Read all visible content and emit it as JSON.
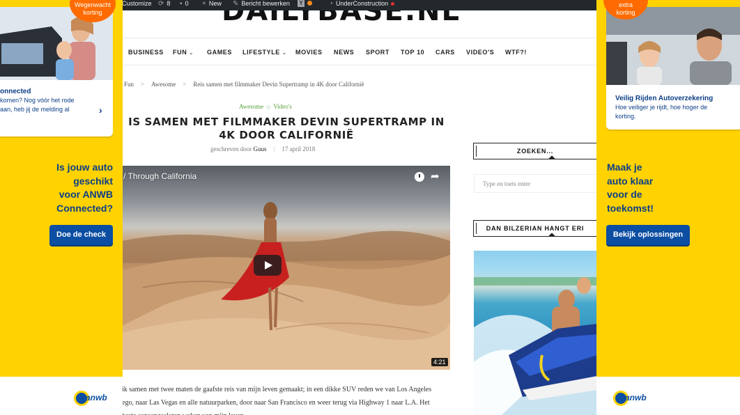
{
  "admin_bar": {
    "customize": "Customize",
    "updates_count": "8",
    "comments_count": "0",
    "new": "New",
    "edit_post": "Bericht bewerken",
    "under_construction": "UnderConstruction"
  },
  "site": {
    "logo": "DAILYBASE.NL"
  },
  "nav": {
    "items": [
      "BUSINESS",
      "FUN",
      "GAMES",
      "LIFESTYLE",
      "MOVIES",
      "NEWS",
      "SPORT",
      "TOP 10",
      "CARS",
      "VIDEO'S",
      "WTF?!"
    ]
  },
  "breadcrumb": [
    "Fun",
    "Awesome",
    "Reis samen met filmmaker Devin Supertramp in 4K door Californië"
  ],
  "post": {
    "categories": [
      "Awesome",
      "Video's"
    ],
    "title": "IS SAMEN MET FILMMAKER DEVIN SUPERTRAMP IN 4K DOOR CALIFORNIË",
    "written_by": "geschreven door",
    "author": "Guus",
    "date": "17 april 2018",
    "video": {
      "title": "/ Through California",
      "duration": "4:21"
    },
    "body_lines": [
      "ik samen met twee maten de gaafste reis van mijn leven gemaakt; in een dikke SUV reden we van Los Angeles",
      "ego, naar Las Vegas en alle natuurparken, door naar San Francisco en weer terug via Highway 1 naar L.A. Het",
      "beste aaneengesloten weken van mijn leven."
    ]
  },
  "sidebar": {
    "search_title": "ZOEKEN...",
    "search_placeholder": "Type en toets enter",
    "widget2_title": "DAN BILZERIAN HANGT ERI"
  },
  "ad_left": {
    "badge": [
      "Wegenwacht",
      "korting"
    ],
    "card_title": "onnected",
    "card_lines": [
      "komen? Nog vóór het rode",
      "aan, heb jij de melding al"
    ],
    "headline": [
      "Is jouw auto",
      "geschikt",
      "voor ANWB",
      "Connected?"
    ],
    "cta": "Doe de check",
    "brand": "anwb"
  },
  "ad_right": {
    "badge": [
      "extra",
      "korting"
    ],
    "card_title": "Veilig Rijden Autoverzekering",
    "card_lines": [
      "Hoe veiliger je rijdt, hoe hoger de",
      "korting."
    ],
    "headline": [
      "Maak je",
      "auto klaar",
      "voor de",
      "toekomst!"
    ],
    "cta": "Bekijk oplossingen",
    "brand": "anwb"
  }
}
